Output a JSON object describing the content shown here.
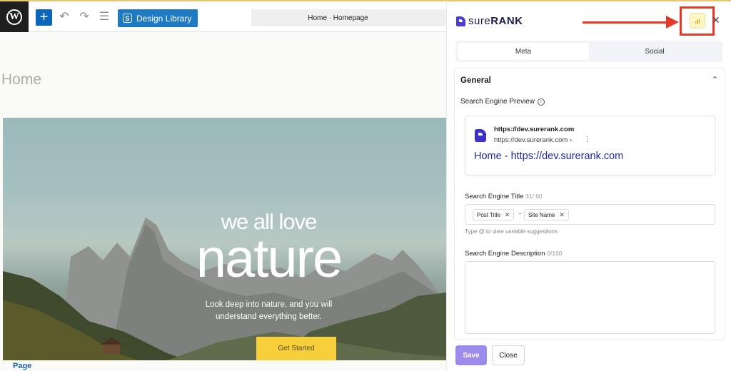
{
  "editor": {
    "toolbar": {
      "add_icon": "plus-icon",
      "design_library_label": "Design Library",
      "document_title": "Home · Homepage"
    },
    "page_heading": "Home",
    "hero": {
      "line1": "we all love",
      "line2": "nature",
      "subtitle_line1": "Look deep into nature, and you will",
      "subtitle_line2": "understand everything better.",
      "button_label": "Get Started"
    },
    "breadcrumb": "Page"
  },
  "surerank": {
    "logo_text_light": "sure",
    "logo_text_bold": "RANK",
    "tabs": [
      {
        "label": "Meta",
        "active": true
      },
      {
        "label": "Social",
        "active": false
      }
    ],
    "section_title": "General",
    "preview_label": "Search Engine Preview",
    "preview": {
      "site": "https://dev.surerank.com",
      "url": "https://dev.surerank.com ›",
      "title": "Home - https://dev.surerank.com"
    },
    "title_field": {
      "label": "Search Engine Title",
      "count": "31/ 60",
      "chips": [
        "Post Title",
        "Site Name"
      ],
      "separator": "-",
      "hint": "Type @ to view variable suggestions"
    },
    "description_field": {
      "label": "Search Engine Description",
      "count": "0/160",
      "value": ""
    },
    "save_label": "Save",
    "close_label": "Close"
  },
  "colors": {
    "accent_blue": "#0a66b8",
    "surerank_purple": "#4b3bd9",
    "save_button": "#9c8bea",
    "highlight_red": "#e43a2a",
    "hero_button": "#f6cf3b"
  }
}
